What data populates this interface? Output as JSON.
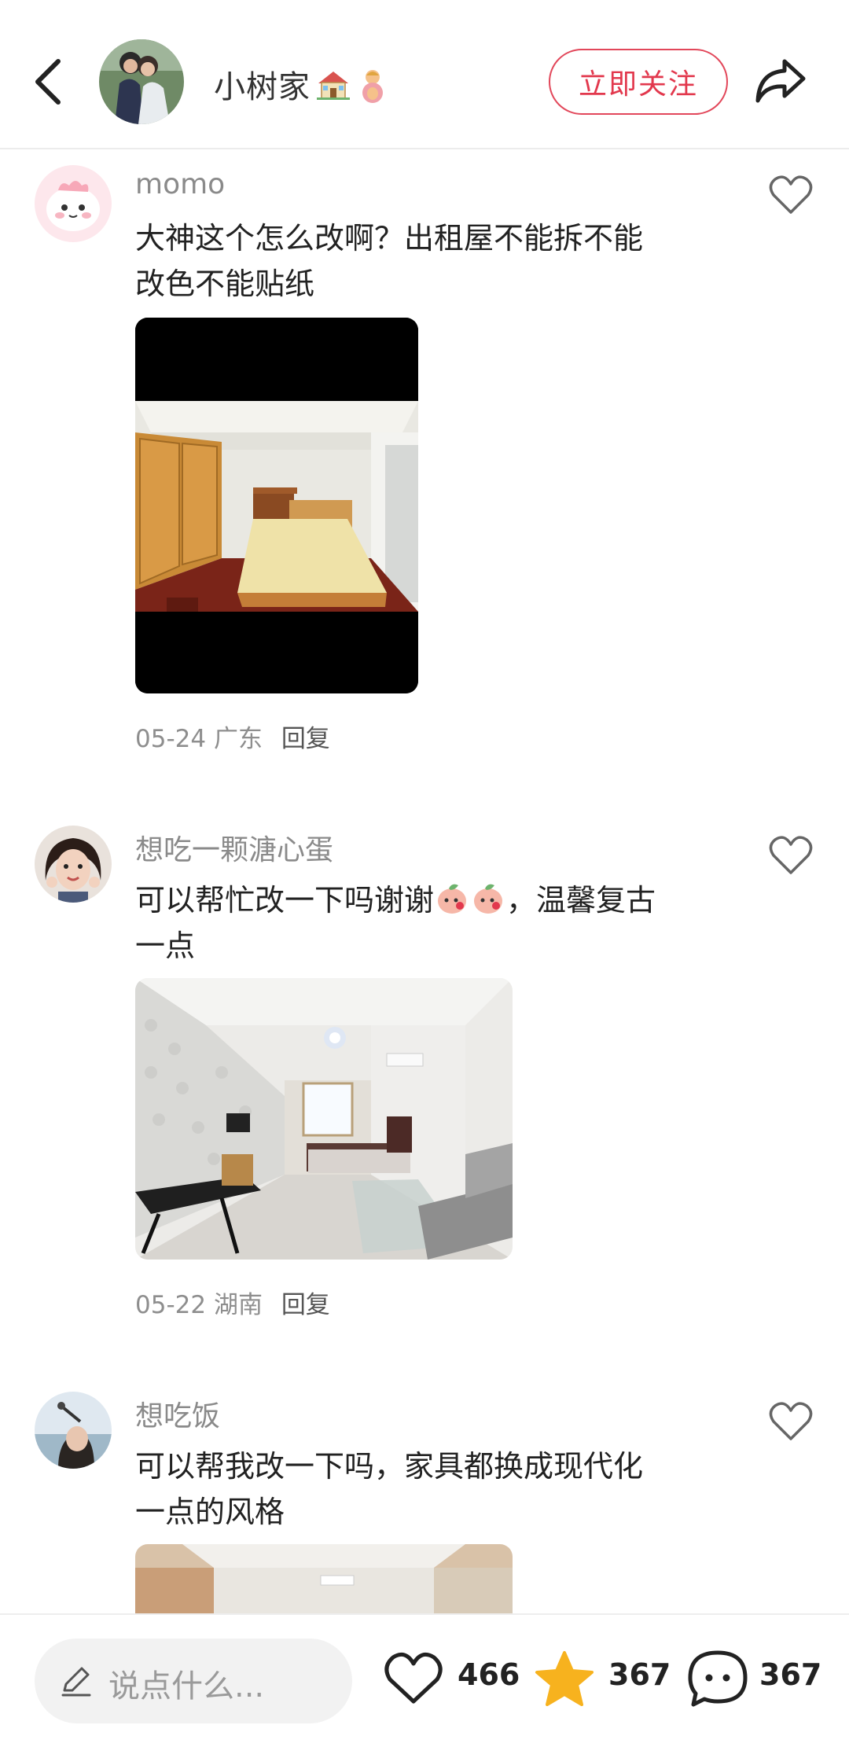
{
  "header": {
    "author_name": "小树家",
    "follow_label": "立即关注"
  },
  "comments": [
    {
      "username": "momo",
      "text_line1": "大神这个怎么改啊？出租屋不能拆不能",
      "text_line2": "改色不能贴纸",
      "date": "05-24",
      "location": "广东",
      "reply_label": "回复"
    },
    {
      "username": "想吃一颗溏心蛋",
      "text_line1a": "可以帮忙改一下吗谢谢",
      "text_line1b": "，温馨复古",
      "text_line2": "一点",
      "date": "05-22",
      "location": "湖南",
      "reply_label": "回复"
    },
    {
      "username": "想吃饭",
      "text_line1": "可以帮我改一下吗，家具都换成现代化",
      "text_line2": "一点的风格"
    }
  ],
  "bottom_bar": {
    "input_placeholder": "说点什么...",
    "likes": "466",
    "favorites": "367",
    "comments": "367"
  },
  "colors": {
    "accent": "#e2384d",
    "star": "#f7b21e"
  }
}
